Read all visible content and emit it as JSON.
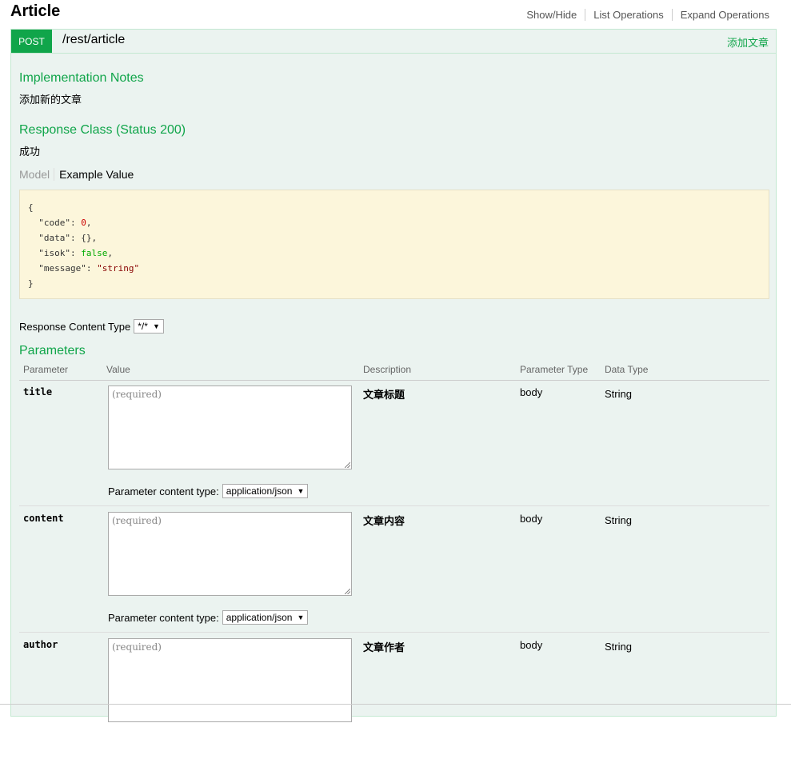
{
  "resource": {
    "title": "Article",
    "links": [
      "Show/Hide",
      "List Operations",
      "Expand Operations"
    ]
  },
  "operation": {
    "method": "POST",
    "path": "/rest/article",
    "summary": "添加文章"
  },
  "implementation": {
    "heading": "Implementation Notes",
    "text": "添加新的文章"
  },
  "response_class": {
    "heading": "Response Class (Status 200)",
    "text": "成功",
    "tabs": [
      "Model",
      "Example Value"
    ],
    "example": {
      "open": "{",
      "close": "}",
      "lines": [
        {
          "key": "\"code\"",
          "value": "0",
          "type": "num",
          "comma": true
        },
        {
          "key": "\"data\"",
          "value": "{}",
          "type": "plain",
          "comma": true
        },
        {
          "key": "\"isok\"",
          "value": "false",
          "type": "bool",
          "comma": true
        },
        {
          "key": "\"message\"",
          "value": "\"string\"",
          "type": "str",
          "comma": false
        }
      ]
    }
  },
  "response_content_type": {
    "label": "Response Content Type",
    "value": "*/*"
  },
  "parameters": {
    "heading": "Parameters",
    "columns": [
      "Parameter",
      "Value",
      "Description",
      "Parameter Type",
      "Data Type"
    ],
    "content_type_label": "Parameter content type:",
    "content_type_value": "application/json",
    "placeholder": "(required)",
    "rows": [
      {
        "name": "title",
        "description": "文章标题",
        "param_type": "body",
        "data_type": "String"
      },
      {
        "name": "content",
        "description": "文章内容",
        "param_type": "body",
        "data_type": "String"
      },
      {
        "name": "author",
        "description": "文章作者",
        "param_type": "body",
        "data_type": "String"
      }
    ]
  },
  "colors": {
    "accent": "#10a54a",
    "operation_bg": "#ebf3f0",
    "example_bg": "#fcf6db"
  }
}
